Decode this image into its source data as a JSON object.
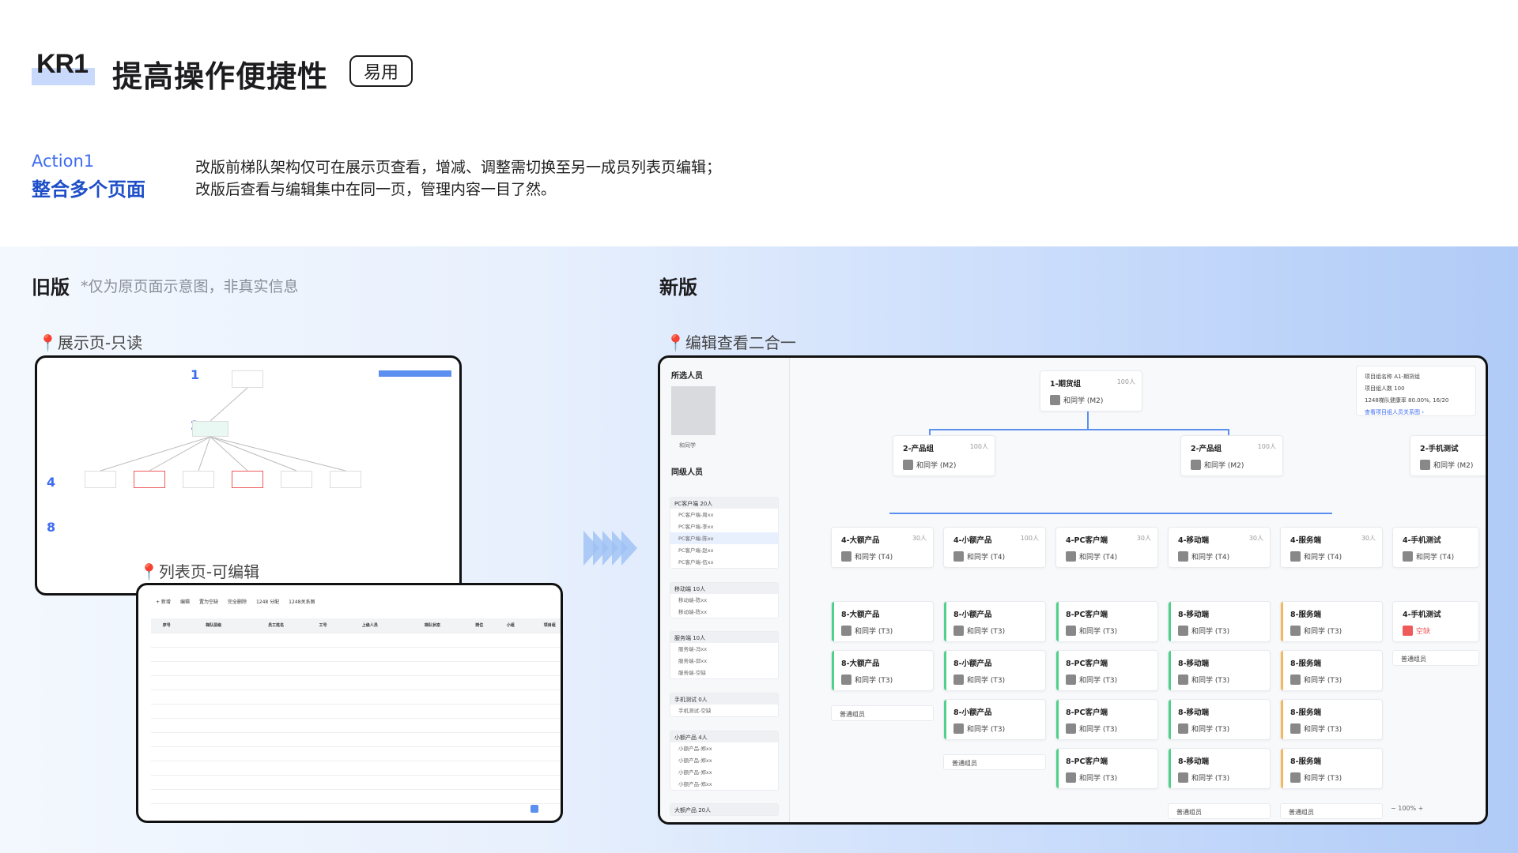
{
  "header": {
    "kr": "KR1",
    "title": "提高操作便捷性",
    "tag": "易用"
  },
  "action": {
    "label": "Action1",
    "title": "整合多个页面",
    "desc1": "改版前梯队架构仅可在展示页查看，增减、调整需切换至另一成员列表页编辑；",
    "desc2": "改版后查看与编辑集中在同一页，管理内容一目了然。"
  },
  "old": {
    "heading": "旧版",
    "note": "*仅为原页面示意图，非真实信息",
    "display_label": "展示页-只读",
    "list_label": "列表页-可编辑",
    "levels": [
      "1",
      "2",
      "4",
      "8"
    ],
    "toolbar": [
      "+ 新增",
      "编辑",
      "置为空缺",
      "完全删除",
      "1248 分配",
      "1248关系图"
    ],
    "columns": [
      "序号",
      "梯队层级",
      "员工姓名",
      "工号",
      "上级人员",
      "梯队状态",
      "岗位",
      "小组",
      "项目组"
    ]
  },
  "new": {
    "heading": "新版",
    "label": "编辑查看二合一",
    "left": {
      "selected": "所选人员",
      "person_name": "和同学",
      "peers": "同级人员",
      "groups": [
        {
          "title": "PC客户端 20人",
          "items": [
            "PC客户端-周xx",
            "PC客户端-李xx",
            "PC客户端-陈xx",
            "PC客户端-赵xx",
            "PC客户端-伍xx"
          ]
        },
        {
          "title": "移动端 10人",
          "items": [
            "移动端-陈xx",
            "移动端-陈xx"
          ]
        },
        {
          "title": "服务端 10人",
          "items": [
            "服务端-冯xx",
            "服务端-邱xx",
            "服务端-空缺"
          ]
        },
        {
          "title": "手机测试 0人",
          "items": [
            "手机测试-空缺"
          ]
        },
        {
          "title": "小额产品 4人",
          "items": [
            "小额产品-郑xx",
            "小额产品-郑xx",
            "小额产品-郑xx",
            "小额产品-郑xx"
          ]
        },
        {
          "title": "大额产品 20人",
          "items": []
        }
      ]
    },
    "info": {
      "a": "项目组名称  A1-期货组",
      "b": "项目组人数  100",
      "c": "1248梯队健康率  80.00%, 16/20",
      "link": "查看项目组人员关系图 ›"
    },
    "top": {
      "title": "1-期货组",
      "count": "100人",
      "person": "和同学 (M2)"
    },
    "l2": [
      {
        "title": "2-产品组",
        "count": "100人",
        "person": "和同学 (M2)"
      },
      {
        "title": "2-产品组",
        "count": "100人",
        "person": "和同学 (M2)"
      },
      {
        "title": "2-手机测试",
        "count": "",
        "person": "和同学 (M2)"
      }
    ],
    "l4": [
      {
        "title": "4-大额产品",
        "count": "30人"
      },
      {
        "title": "4-小额产品",
        "count": "100人"
      },
      {
        "title": "4-PC客户端",
        "count": "30人"
      },
      {
        "title": "4-移动端",
        "count": "30人"
      },
      {
        "title": "4-服务端",
        "count": "30人"
      },
      {
        "title": "4-手机测试",
        "count": ""
      }
    ],
    "l4_person": "和同学 (T4)",
    "l8_person": "和同学 (T3)",
    "vacant": "空缺",
    "normal": "普通组员",
    "zoom": "100%"
  },
  "colors": {
    "accent": "#3d6cf0",
    "bar_blue": "#5b8ff0",
    "bar_green": "#4fd18b",
    "bar_orange": "#f5b860",
    "bar_red": "#ef5a5a"
  }
}
